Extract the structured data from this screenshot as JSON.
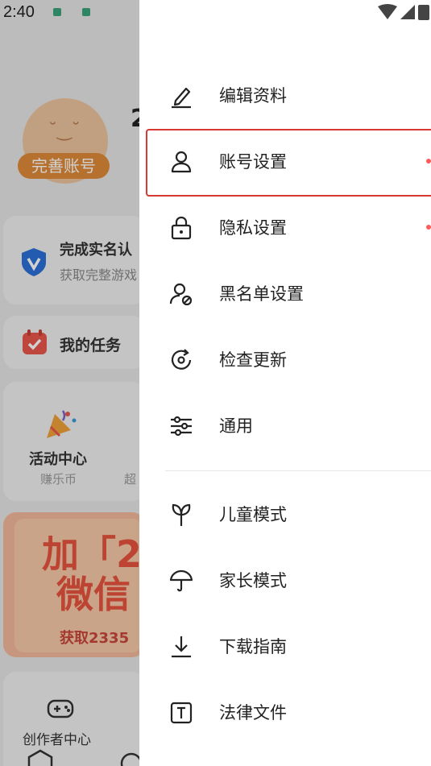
{
  "status_bar": {
    "time": "2:40"
  },
  "background": {
    "complete_account_badge": "完善账号",
    "name_peek": "2",
    "realname": {
      "title": "完成实名认",
      "subtitle": "获取完整游戏"
    },
    "tasks": {
      "label": "我的任务"
    },
    "activity": {
      "label": "活动中心",
      "sub": "赚乐币",
      "sub2": "超"
    },
    "banner": {
      "line1": "加「2",
      "line2": "微信",
      "sub": "获取2335"
    },
    "creator": {
      "label": "创作者中心"
    }
  },
  "drawer": {
    "items": [
      {
        "label": "编辑资料",
        "icon": "edit-icon",
        "has_dot": false
      },
      {
        "label": "账号设置",
        "icon": "user-icon",
        "has_dot": true,
        "highlighted": true
      },
      {
        "label": "隐私设置",
        "icon": "lock-icon",
        "has_dot": true
      },
      {
        "label": "黑名单设置",
        "icon": "blocked-user-icon",
        "has_dot": false
      },
      {
        "label": "检查更新",
        "icon": "update-icon",
        "has_dot": false
      },
      {
        "label": "通用",
        "icon": "sliders-icon",
        "has_dot": false
      },
      {
        "label": "儿童模式",
        "icon": "sprout-icon",
        "has_dot": false
      },
      {
        "label": "家长模式",
        "icon": "umbrella-icon",
        "has_dot": false
      },
      {
        "label": "下载指南",
        "icon": "download-icon",
        "has_dot": false
      },
      {
        "label": "法律文件",
        "icon": "text-doc-icon",
        "has_dot": false
      }
    ]
  },
  "colors": {
    "highlight_border": "#d63a32",
    "notification_dot": "#ff5a5a"
  }
}
